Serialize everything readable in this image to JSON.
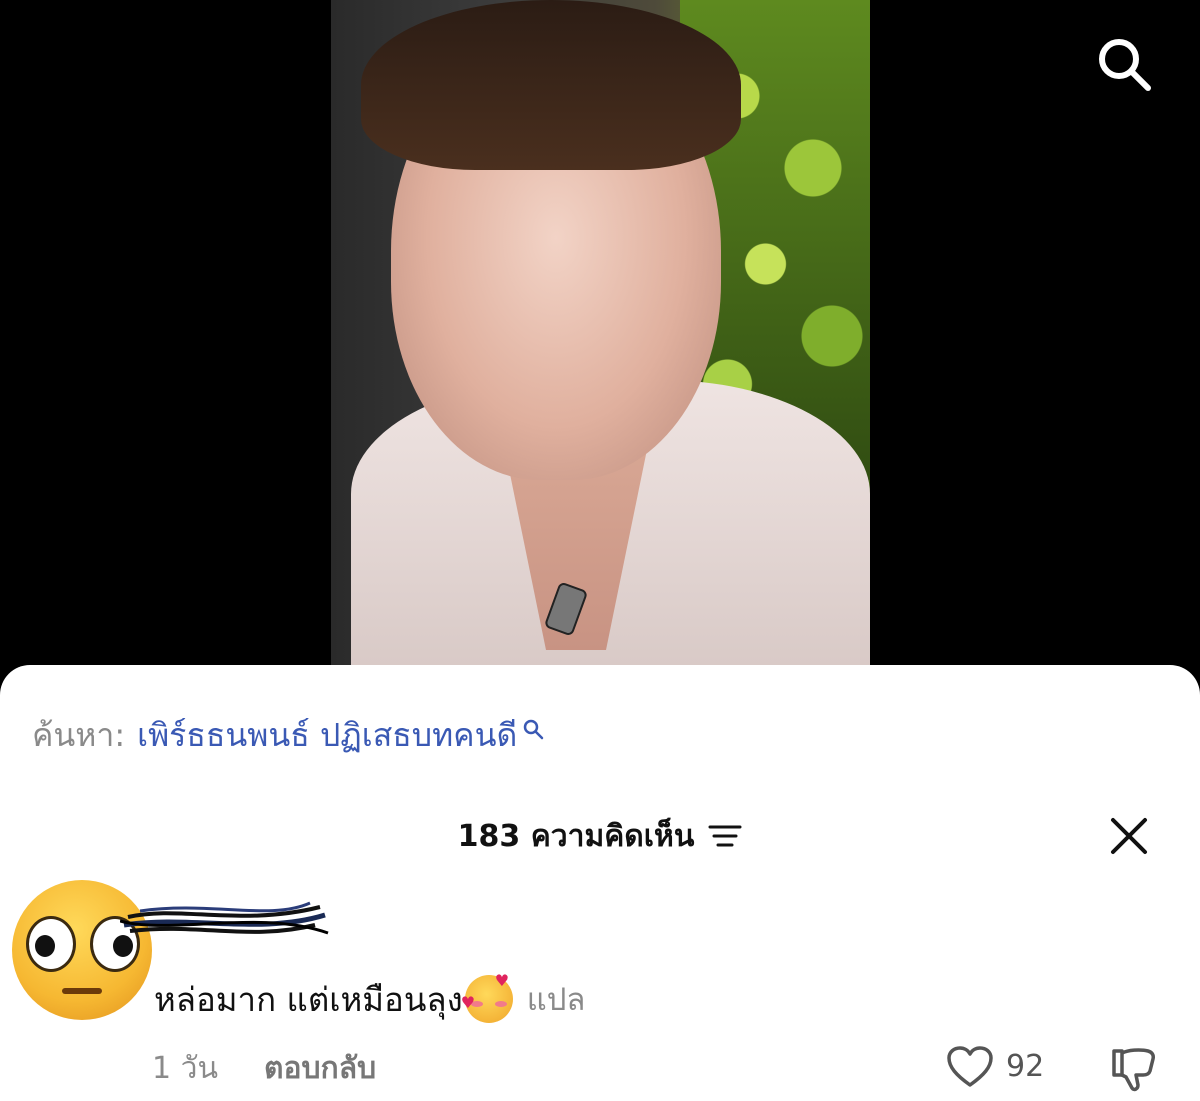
{
  "top": {
    "search_icon": "search-icon"
  },
  "search": {
    "prefix": "ค้นหา:",
    "term": "เพิร์ธธนพนธ์ ปฏิเสธบทคนดี"
  },
  "comments": {
    "count_label": "183 ความคิดเห็น",
    "sort_icon": "sort-icon",
    "close_icon": "close-icon"
  },
  "comment": {
    "text": "หล่อมาก แต่เหมือนลุง",
    "translate": "แปล",
    "time": "1 วัน",
    "reply": "ตอบกลับ",
    "likes": "92"
  },
  "colors": {
    "link_blue": "#3a59b4",
    "muted_gray": "#8a8a8a",
    "sheet_bg": "#ffffff",
    "page_bg": "#000000"
  }
}
